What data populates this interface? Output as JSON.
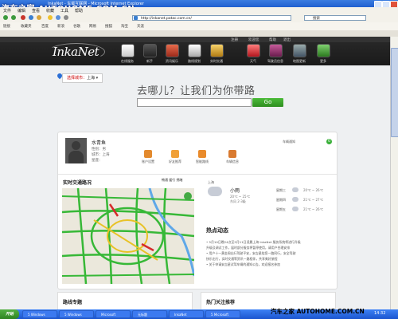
{
  "watermark": {
    "top": "汽车之家 AUTOHOME.COM.CN",
    "bottom": "汽车之家 AUTOHOME.COM.CN"
  },
  "window": {
    "title": "InkaNet - 车载互联网 - Microsoft Internet Explorer"
  },
  "menu": [
    "文件",
    "编辑",
    "查看",
    "收藏",
    "工具",
    "帮助"
  ],
  "address": {
    "url": "http://inkanet.patac.com.cn/"
  },
  "search": {
    "placeholder": "搜索"
  },
  "links": [
    "链接",
    "收藏夹",
    "百度",
    "新浪",
    "谷歌",
    "网易",
    "搜狐",
    "淘宝",
    "天涯"
  ],
  "site": {
    "util": {
      "first": "注册",
      "user": "欢迎您",
      "help": "帮助",
      "exit": "退出"
    },
    "logo": "InkaNet",
    "nav": [
      "在线服务",
      "新手",
      "资讯娱乐",
      "路线规划",
      "实时交通",
      "天气",
      "驾驶员信息",
      "地图更新",
      "更多"
    ],
    "city_label": "选择城市：",
    "city": "上海",
    "slogan": "去哪儿？让我们为你带路",
    "go": "Go"
  },
  "profile": {
    "name": "水青鱼",
    "gender": "性别：男",
    "city": "城市：上海",
    "login": "星座：",
    "sync_label": "车辆通知",
    "sync_count": "0",
    "actions": [
      "账户设置",
      "好友推荐",
      "智能路线",
      "车辆信息"
    ]
  },
  "traffic": {
    "title": "实时交通路况",
    "legend": "畅通 缓行 拥堵"
  },
  "weather": {
    "city": "上海",
    "cond": "小雨",
    "temp": "20℃ ~ 25℃",
    "wind": "东风 2-3级",
    "days": [
      {
        "label": "星期三",
        "t": "20℃ ~ 26℃"
      },
      {
        "label": "星期四",
        "t": "21℃ ~ 27℃"
      },
      {
        "label": "星期五",
        "t": "21℃ ~ 26℃"
      }
    ]
  },
  "news": {
    "title": "热点动态",
    "items": [
      "• 5月10日晚24点至5月11日凌晨上海 InkaNet 服务系统将进行升级",
      "  升级及调试工作，届时部分服务将暂停使用，请用户合理安排",
      "• 用户十一黄金周出行驾驶平安，安吉星陪您一路同行，安全驾驶",
      "  快乐出行，实时交通等资讯一路相伴，共享美好旅程",
      "• 关于申请安吉星试驾车辆的通知公告，欢迎报名参加"
    ]
  },
  "bottom": {
    "left": "路线专题",
    "right": "热门关注推荐"
  },
  "taskbar": {
    "start": "开始",
    "tasks": [
      "5 Windows",
      "5 Windows",
      "Microsoft",
      "无标题",
      "InkaNet",
      "5 Microsoft"
    ],
    "time": "14:32"
  }
}
